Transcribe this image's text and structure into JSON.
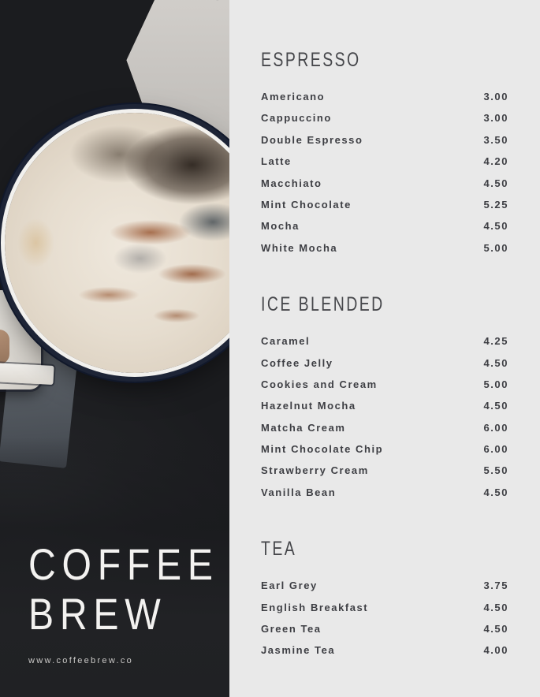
{
  "brand": {
    "name_line1": "COFFEE",
    "name_line2": "BREW",
    "website": "www.coffeebrew.co"
  },
  "photo": {
    "alt": "overhead photo of a white enamel mug of coffee with cinnamon dusting on a dark surface",
    "background_color": "#212225",
    "stone_color": "#cfccc8",
    "mug_rim_color": "#1d2436",
    "foam_color": "#e6ddcf",
    "cinnamon_color": "#8e4c28"
  },
  "colors": {
    "panel_background": "#e9e9e9",
    "text": "#3d3e43",
    "heading": "#46474b",
    "brand_text": "#f3f2f0",
    "brand_url_text": "#c9c8c6"
  },
  "menu": {
    "sections": [
      {
        "title": "ESPRESSO",
        "items": [
          {
            "name": "Americano",
            "price": "3.00"
          },
          {
            "name": "Cappuccino",
            "price": "3.00"
          },
          {
            "name": "Double Espresso",
            "price": "3.50"
          },
          {
            "name": "Latte",
            "price": "4.20"
          },
          {
            "name": "Macchiato",
            "price": "4.50"
          },
          {
            "name": "Mint Chocolate",
            "price": "5.25"
          },
          {
            "name": "Mocha",
            "price": "4.50"
          },
          {
            "name": "White Mocha",
            "price": "5.00"
          }
        ]
      },
      {
        "title": "ICE BLENDED",
        "items": [
          {
            "name": "Caramel",
            "price": "4.25"
          },
          {
            "name": "Coffee Jelly",
            "price": "4.50"
          },
          {
            "name": "Cookies and Cream",
            "price": "5.00"
          },
          {
            "name": "Hazelnut Mocha",
            "price": "4.50"
          },
          {
            "name": "Matcha Cream",
            "price": "6.00"
          },
          {
            "name": "Mint Chocolate Chip",
            "price": "6.00"
          },
          {
            "name": "Strawberry Cream",
            "price": "5.50"
          },
          {
            "name": "Vanilla Bean",
            "price": "4.50"
          }
        ]
      },
      {
        "title": "TEA",
        "items": [
          {
            "name": "Earl Grey",
            "price": "3.75"
          },
          {
            "name": "English Breakfast",
            "price": "4.50"
          },
          {
            "name": "Green Tea",
            "price": "4.50"
          },
          {
            "name": "Jasmine Tea",
            "price": "4.00"
          }
        ]
      }
    ]
  }
}
